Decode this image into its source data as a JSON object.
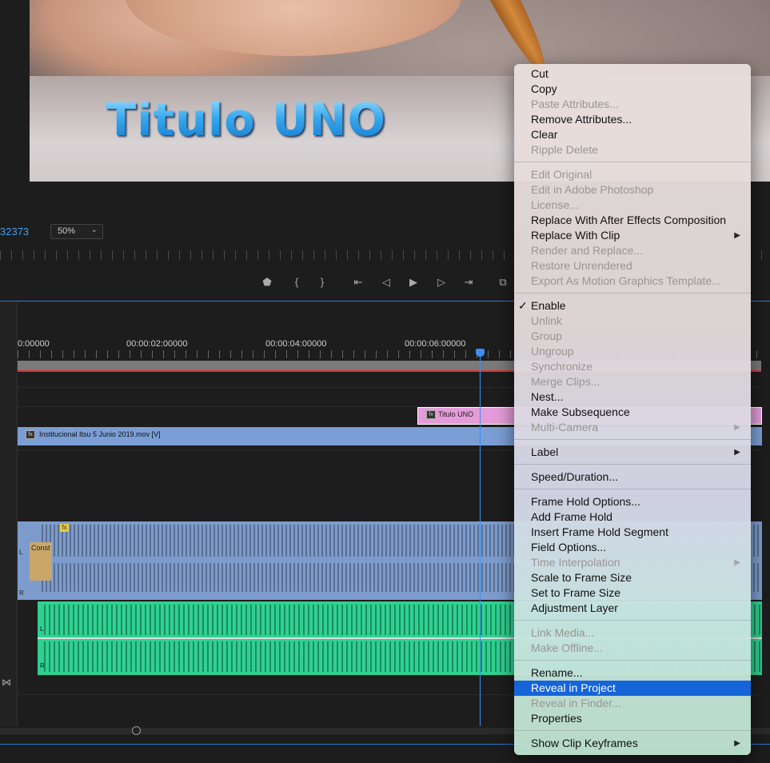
{
  "viewer": {
    "overlay_title": "Titulo UNO",
    "timecode": "32373",
    "zoom": "50%"
  },
  "transport": {
    "icons": [
      "marker-icon",
      "in-point-icon",
      "out-point-icon",
      "go-to-in-icon",
      "step-back-icon",
      "play-icon",
      "step-forward-icon",
      "go-to-out-icon",
      "lift-icon"
    ],
    "glyphs": [
      "⬟",
      "{",
      "}",
      "⇤",
      "◁",
      "▶",
      "▷",
      "⇥",
      "⧉"
    ]
  },
  "timeline": {
    "timecodes": [
      "0:00000",
      "00:00:02:00000",
      "00:00:04:00000",
      "00:00:06:00000"
    ],
    "clips": {
      "title_clip": "Titulo UNO",
      "video_clip": "Institucional Itsu 5 Junio 2019.mov [V]",
      "audio_fx": "fx",
      "transition": "Const",
      "channel_l": "L",
      "channel_r": "R"
    }
  },
  "context_menu": {
    "groups": [
      [
        {
          "label": "Cut",
          "enabled": true
        },
        {
          "label": "Copy",
          "enabled": true
        },
        {
          "label": "Paste Attributes...",
          "enabled": false
        },
        {
          "label": "Remove Attributes...",
          "enabled": true
        },
        {
          "label": "Clear",
          "enabled": true
        },
        {
          "label": "Ripple Delete",
          "enabled": false
        }
      ],
      [
        {
          "label": "Edit Original",
          "enabled": false
        },
        {
          "label": "Edit in Adobe Photoshop",
          "enabled": false
        },
        {
          "label": "License...",
          "enabled": false
        },
        {
          "label": "Replace With After Effects Composition",
          "enabled": true
        },
        {
          "label": "Replace With Clip",
          "enabled": true,
          "submenu": true
        },
        {
          "label": "Render and Replace...",
          "enabled": false
        },
        {
          "label": "Restore Unrendered",
          "enabled": false
        },
        {
          "label": "Export As Motion Graphics Template...",
          "enabled": false
        }
      ],
      [
        {
          "label": "Enable",
          "enabled": true,
          "checked": true
        },
        {
          "label": "Unlink",
          "enabled": false
        },
        {
          "label": "Group",
          "enabled": false
        },
        {
          "label": "Ungroup",
          "enabled": false
        },
        {
          "label": "Synchronize",
          "enabled": false
        },
        {
          "label": "Merge Clips...",
          "enabled": false
        },
        {
          "label": "Nest...",
          "enabled": true
        },
        {
          "label": "Make Subsequence",
          "enabled": true
        },
        {
          "label": "Multi-Camera",
          "enabled": false,
          "submenu": true
        }
      ],
      [
        {
          "label": "Label",
          "enabled": true,
          "submenu": true
        }
      ],
      [
        {
          "label": "Speed/Duration...",
          "enabled": true
        }
      ],
      [
        {
          "label": "Frame Hold Options...",
          "enabled": true
        },
        {
          "label": "Add Frame Hold",
          "enabled": true
        },
        {
          "label": "Insert Frame Hold Segment",
          "enabled": true
        },
        {
          "label": "Field Options...",
          "enabled": true
        },
        {
          "label": "Time Interpolation",
          "enabled": false,
          "submenu": true
        },
        {
          "label": "Scale to Frame Size",
          "enabled": true
        },
        {
          "label": "Set to Frame Size",
          "enabled": true
        },
        {
          "label": "Adjustment Layer",
          "enabled": true
        }
      ],
      [
        {
          "label": "Link Media...",
          "enabled": false
        },
        {
          "label": "Make Offline...",
          "enabled": false
        }
      ],
      [
        {
          "label": "Rename...",
          "enabled": true
        },
        {
          "label": "Reveal in Project",
          "enabled": true,
          "selected": true
        },
        {
          "label": "Reveal in Finder...",
          "enabled": false
        },
        {
          "label": "Properties",
          "enabled": true
        }
      ],
      [
        {
          "label": "Show Clip Keyframes",
          "enabled": true,
          "submenu": true
        }
      ]
    ],
    "check_glyph": "✓",
    "submenu_glyph": "▶"
  }
}
